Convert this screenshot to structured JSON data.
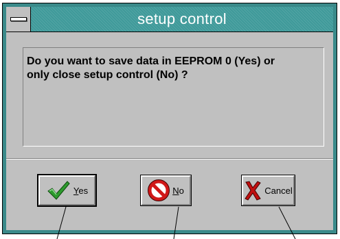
{
  "window": {
    "title": "setup control"
  },
  "message": {
    "line1": "Do you want to save data in EEPROM 0 (Yes) or",
    "line2": "only close setup control (No) ?"
  },
  "buttons": {
    "yes": {
      "label_mnemonic": "Y",
      "label_rest": "es",
      "icon": "checkmark-icon",
      "default": true
    },
    "no": {
      "label_mnemonic": "N",
      "label_rest": "o",
      "icon": "prohibited-icon"
    },
    "cancel": {
      "label_mnemonic": "",
      "label_rest": "Cancel",
      "icon": "red-x-icon"
    }
  },
  "colors": {
    "frame": "#3a8a8a",
    "titlebar": "#3f9a9a",
    "face": "#c0c0c0",
    "check": "#2e9a2e",
    "no_red": "#d01818",
    "cancel_red": "#c01010"
  }
}
